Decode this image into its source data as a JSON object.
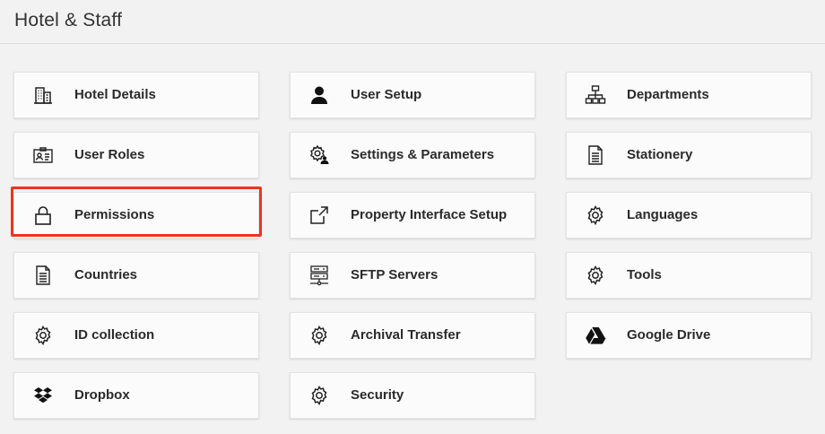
{
  "page": {
    "title": "Hotel & Staff"
  },
  "columns": [
    {
      "tiles": [
        {
          "label": "Hotel Details",
          "icon": "building-icon"
        },
        {
          "label": "User Roles",
          "icon": "id-card-icon"
        },
        {
          "label": "Permissions",
          "icon": "lock-icon"
        },
        {
          "label": "Countries",
          "icon": "document-icon"
        },
        {
          "label": "ID collection",
          "icon": "gear-icon"
        },
        {
          "label": "Dropbox",
          "icon": "dropbox-icon"
        }
      ]
    },
    {
      "tiles": [
        {
          "label": "User Setup",
          "icon": "user-icon"
        },
        {
          "label": "Settings & Parameters",
          "icon": "user-gear-icon"
        },
        {
          "label": "Property Interface Setup",
          "icon": "external-link-icon"
        },
        {
          "label": "SFTP Servers",
          "icon": "server-icon"
        },
        {
          "label": "Archival Transfer",
          "icon": "gear-icon"
        },
        {
          "label": "Security",
          "icon": "gear-icon"
        }
      ]
    },
    {
      "tiles": [
        {
          "label": "Departments",
          "icon": "org-chart-icon"
        },
        {
          "label": "Stationery",
          "icon": "document-icon"
        },
        {
          "label": "Languages",
          "icon": "gear-icon"
        },
        {
          "label": "Tools",
          "icon": "gear-icon"
        },
        {
          "label": "Google Drive",
          "icon": "google-drive-icon"
        }
      ]
    }
  ],
  "highlight": {
    "target": "Permissions",
    "color": "#ee3322"
  }
}
